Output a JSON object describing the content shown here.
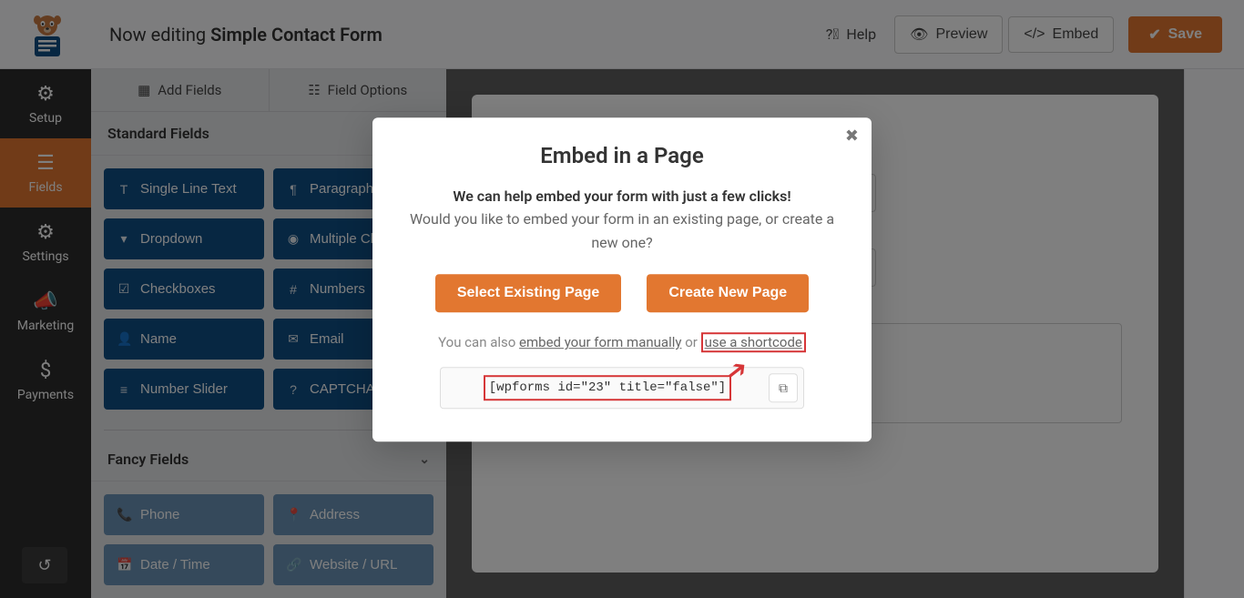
{
  "header": {
    "editing_prefix": "Now editing ",
    "form_name": "Simple Contact Form",
    "help": "Help",
    "preview": "Preview",
    "embed": "Embed",
    "save": "Save"
  },
  "sidebar": {
    "items": [
      {
        "label": "Setup",
        "icon": "gear"
      },
      {
        "label": "Fields",
        "icon": "list"
      },
      {
        "label": "Settings",
        "icon": "sliders"
      },
      {
        "label": "Marketing",
        "icon": "bullhorn"
      },
      {
        "label": "Payments",
        "icon": "dollar"
      }
    ]
  },
  "fields_panel": {
    "tabs": {
      "add": "Add Fields",
      "options": "Field Options"
    },
    "standard_title": "Standard Fields",
    "standard": [
      {
        "label": "Single Line Text",
        "icon": "T"
      },
      {
        "label": "Paragraph Text",
        "icon": "¶"
      },
      {
        "label": "Dropdown",
        "icon": "▾"
      },
      {
        "label": "Multiple Choice",
        "icon": "◉"
      },
      {
        "label": "Checkboxes",
        "icon": "☑"
      },
      {
        "label": "Numbers",
        "icon": "#"
      },
      {
        "label": "Name",
        "icon": "👤"
      },
      {
        "label": "Email",
        "icon": "✉"
      },
      {
        "label": "Number Slider",
        "icon": "≡"
      },
      {
        "label": "CAPTCHA",
        "icon": "?"
      }
    ],
    "fancy_title": "Fancy Fields",
    "fancy": [
      {
        "label": "Phone",
        "icon": "📞"
      },
      {
        "label": "Address",
        "icon": "📍"
      },
      {
        "label": "Date / Time",
        "icon": "📅"
      },
      {
        "label": "Website / URL",
        "icon": "🔗"
      }
    ]
  },
  "form": {
    "title": "Simple Contact Form"
  },
  "modal": {
    "title": "Embed in a Page",
    "lead": "We can help embed your form with just a few clicks!",
    "sub": "Would you like to embed your form in an existing page, or create a new one?",
    "select_btn": "Select Existing Page",
    "create_btn": "Create New Page",
    "help_prefix": "You can also ",
    "manual_link": "embed your form manually",
    "help_or": " or ",
    "shortcode_link": "use a shortcode",
    "shortcode": "[wpforms id=\"23\" title=\"false\"]"
  }
}
